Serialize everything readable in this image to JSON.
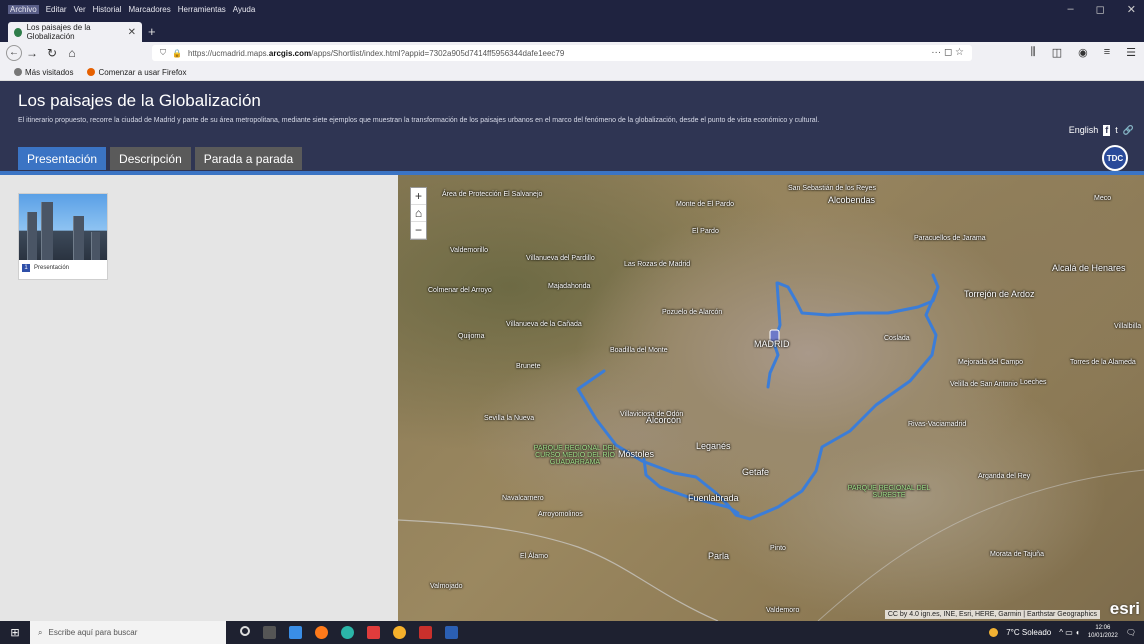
{
  "window": {
    "menu": [
      "Archivo",
      "Editar",
      "Ver",
      "Historial",
      "Marcadores",
      "Herramientas",
      "Ayuda"
    ],
    "controls": [
      "–",
      "◻",
      "✕"
    ]
  },
  "browser_tab": {
    "title": "Los paisajes de la Globalización",
    "close": "✕",
    "new_tab": "+"
  },
  "nav": {
    "back": "←",
    "forward": "→",
    "reload": "↻",
    "home": "⌂",
    "url_prefix": "https://ucmadrid.maps.",
    "url_domain": "arcgis.com",
    "url_suffix": "/apps/Shortlist/index.html?appid=7302a905d7414ff5956344dafe1eec79",
    "actions": "··· ◻ ☆",
    "tools": [
      "⫼",
      "◫",
      "◉",
      "≡",
      "☰"
    ]
  },
  "bookmarks": [
    {
      "label": "Más visitados",
      "icon": "gear-icon",
      "color": "#777777"
    },
    {
      "label": "Comenzar a usar Firefox",
      "icon": "firefox-icon",
      "color": "#e66000"
    }
  ],
  "app": {
    "title": "Los paisajes de la Globalización",
    "subtitle": "El itinerario propuesto, recorre la ciudad de Madrid y parte de su área metropolitana, mediante siete ejemplos que muestran la transformación de los paisajes urbanos en el marco del fenómeno de la globalización, desde el punto de vista económico y cultural.",
    "language": "English",
    "share_icons": [
      "f",
      "t",
      "🔗"
    ],
    "logo_text": "TDC"
  },
  "tabs": [
    {
      "label": "Presentación",
      "active": true
    },
    {
      "label": "Descripción",
      "active": false
    },
    {
      "label": "Parada a parada",
      "active": false
    }
  ],
  "sidebar": {
    "card": {
      "number": "1",
      "label": "Presentación"
    }
  },
  "map": {
    "zoom": [
      "+",
      "⌂",
      "−"
    ],
    "places": [
      "San Sebastián de los Reyes",
      "Alcobendas",
      "El Pardo",
      "Monte de El Pardo",
      "Área de Protección El Salvanejo",
      "Majadahonda",
      "Las Rozas de Madrid",
      "Villanueva del Pardillo",
      "Valdemorillo",
      "Colmenar del Arroyo",
      "Pozuelo de Alarcón",
      "Boadilla del Monte",
      "Villanueva de la Cañada",
      "Quijorna",
      "Brunete",
      "MADRID",
      "Coslada",
      "Torrejón de Ardoz",
      "Alcalá de Henares",
      "Paracuellos de Jarama",
      "Rivas-Vaciamadrid",
      "Mejorada del Campo",
      "Velilla de San Antonio",
      "Loeches",
      "Torres de la Alameda",
      "Alcorcón",
      "Leganés",
      "Getafe",
      "Móstoles",
      "Fuenlabrada",
      "Arroyomolinos",
      "Navalcarnero",
      "Sevilla la Nueva",
      "Villaviciosa de Odón",
      "Parla",
      "Pinto",
      "El Álamo",
      "Valdemoro",
      "Arganda del Rey",
      "Morata de Tajuña",
      "Villalbilla",
      "Valmojado",
      "Meco"
    ],
    "parks": [
      "PARQUE REGIONAL DEL CURSO MEDIO DEL RÍO GUADARRAMA",
      "PARQUE REGIONAL DEL SURESTE"
    ],
    "attribution": "CC by 4.0 ign.es, INE, Esri, HERE, Garmin | Earthstar Geographics",
    "brand": "esri",
    "route_color": "#3b7dd8"
  },
  "taskbar": {
    "search_placeholder": "Escribe aquí para buscar",
    "weather": "7°C  Soleado",
    "time": "12:06",
    "date": "10/01/2022"
  }
}
